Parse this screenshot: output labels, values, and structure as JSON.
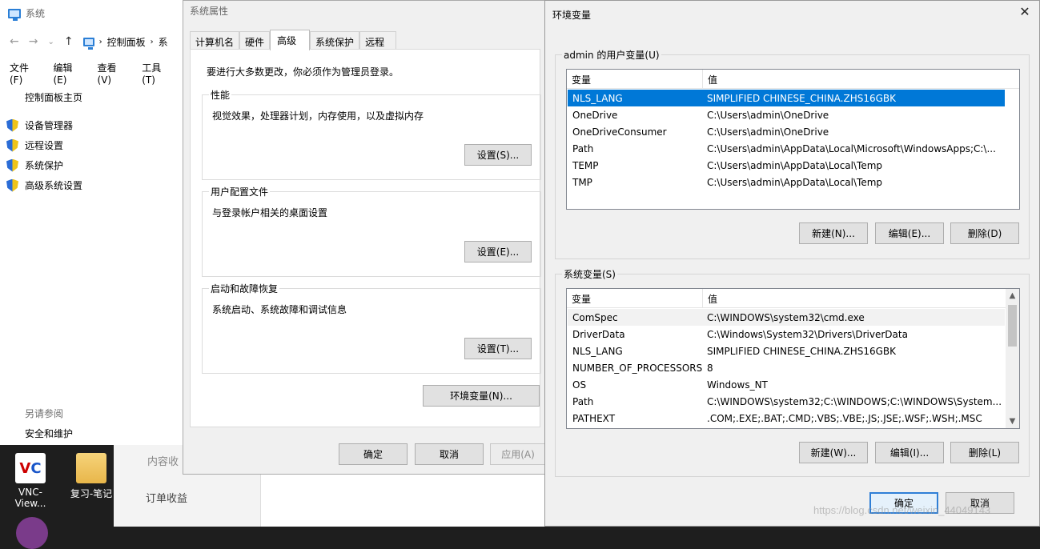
{
  "desktop": {
    "icons": [
      {
        "label": "VNC-View..."
      },
      {
        "label": "复习-笔记"
      }
    ],
    "bg_app": {
      "item1": "内容收",
      "item2": "订单收益"
    }
  },
  "system_window": {
    "title": "系统",
    "breadcrumb": "控制面板",
    "breadcrumb_next": "系",
    "menu": [
      "文件(F)",
      "编辑(E)",
      "查看(V)",
      "工具(T)"
    ],
    "home_link": "控制面板主页",
    "tasks": [
      "设备管理器",
      "远程设置",
      "系统保护",
      "高级系统设置"
    ],
    "see_also": "另请参阅",
    "security": "安全和维护"
  },
  "system_properties": {
    "title": "系统属性",
    "tabs": [
      "计算机名",
      "硬件",
      "高级",
      "系统保护",
      "远程"
    ],
    "active_tab": "高级",
    "admin_note": "要进行大多数更改，你必须作为管理员登录。",
    "groups": [
      {
        "title": "性能",
        "desc": "视觉效果，处理器计划，内存使用，以及虚拟内存",
        "button": "设置(S)..."
      },
      {
        "title": "用户配置文件",
        "desc": "与登录帐户相关的桌面设置",
        "button": "设置(E)..."
      },
      {
        "title": "启动和故障恢复",
        "desc": "系统启动、系统故障和调试信息",
        "button": "设置(T)..."
      }
    ],
    "env_button": "环境变量(N)...",
    "ok": "确定",
    "cancel": "取消",
    "apply": "应用(A)"
  },
  "env_vars": {
    "title": "环境变量",
    "user_section": "admin 的用户变量(U)",
    "system_section": "系统变量(S)",
    "col_name": "变量",
    "col_value": "值",
    "user_vars": [
      {
        "name": "NLS_LANG",
        "value": "SIMPLIFIED CHINESE_CHINA.ZHS16GBK"
      },
      {
        "name": "OneDrive",
        "value": "C:\\Users\\admin\\OneDrive"
      },
      {
        "name": "OneDriveConsumer",
        "value": "C:\\Users\\admin\\OneDrive"
      },
      {
        "name": "Path",
        "value": "C:\\Users\\admin\\AppData\\Local\\Microsoft\\WindowsApps;C:\\..."
      },
      {
        "name": "TEMP",
        "value": "C:\\Users\\admin\\AppData\\Local\\Temp"
      },
      {
        "name": "TMP",
        "value": "C:\\Users\\admin\\AppData\\Local\\Temp"
      }
    ],
    "system_vars": [
      {
        "name": "ComSpec",
        "value": "C:\\WINDOWS\\system32\\cmd.exe"
      },
      {
        "name": "DriverData",
        "value": "C:\\Windows\\System32\\Drivers\\DriverData"
      },
      {
        "name": "NLS_LANG",
        "value": "SIMPLIFIED CHINESE_CHINA.ZHS16GBK"
      },
      {
        "name": "NUMBER_OF_PROCESSORS",
        "value": "8"
      },
      {
        "name": "OS",
        "value": "Windows_NT"
      },
      {
        "name": "Path",
        "value": "C:\\WINDOWS\\system32;C:\\WINDOWS;C:\\WINDOWS\\System..."
      },
      {
        "name": "PATHEXT",
        "value": ".COM;.EXE;.BAT;.CMD;.VBS;.VBE;.JS;.JSE;.WSF;.WSH;.MSC"
      }
    ],
    "user_buttons": {
      "new": "新建(N)...",
      "edit": "编辑(E)...",
      "delete": "删除(D)"
    },
    "system_buttons": {
      "new": "新建(W)...",
      "edit": "编辑(I)...",
      "delete": "删除(L)"
    },
    "ok": "确定",
    "cancel": "取消",
    "selection_color": "#0078d7"
  },
  "watermark": "https://blog.csdn.net/weixin_44049143"
}
